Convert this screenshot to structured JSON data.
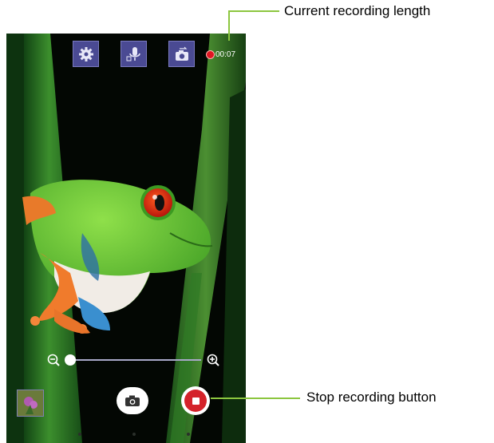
{
  "camera": {
    "top_bar": {
      "settings_icon": "gear-icon",
      "audio_icon": "microphone-icon",
      "switch_camera_icon": "camera-switch-icon",
      "recording_time": "00:07"
    },
    "zoom": {
      "out_icon": "zoom-out-icon",
      "in_icon": "zoom-in-icon",
      "level": 0.0
    },
    "bottom_bar": {
      "gallery_icon": "gallery-thumbnail",
      "snapshot_icon": "camera-icon",
      "stop_icon": "stop-icon"
    }
  },
  "callouts": {
    "recording_length": "Current recording length",
    "stop_button": "Stop recording button"
  },
  "colors": {
    "callout_line": "#8cc63f",
    "record_red": "#d4222a",
    "toolbar_button": "#4a4a93"
  }
}
